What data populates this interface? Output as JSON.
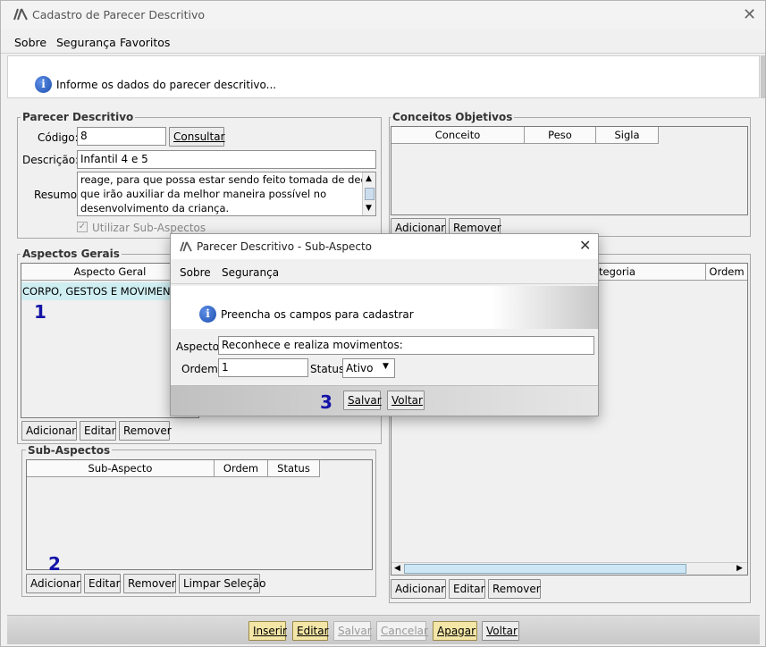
{
  "window": {
    "title": "Cadastro de Parecer Descritivo"
  },
  "menu": [
    "Sobre",
    "Segurança",
    "Favoritos"
  ],
  "info": "Informe os dados do parecer descritivo...",
  "parecer": {
    "group_title": "Parecer Descritivo",
    "codigo_label": "Código:",
    "codigo_value": "8",
    "consultar": "Consultar",
    "descricao_label": "Descrição:*",
    "descricao_value": "Infantil 4 e 5",
    "resumo_label": "Resumo:",
    "resumo_lines": [
      "reage, para que possa estar sendo feito tomada de decisões",
      "que irão  auxiliar da melhor maneira possível no",
      "desenvolvimento da criança."
    ],
    "utilizar_label": "Utilizar Sub-Aspectos"
  },
  "conceitos": {
    "group_title": "Conceitos Objetivos",
    "headers": [
      "Conceito",
      "Peso",
      "Sigla"
    ],
    "adicionar": "Adicionar",
    "remover": "Remover"
  },
  "aspectos": {
    "group_title": "Aspectos Gerais",
    "header": "Aspecto Geral",
    "row": "CORPO, GESTOS E MOVIMENTOS",
    "adicionar": "Adicionar",
    "editar": "Editar",
    "remover": "Remover"
  },
  "subaspectos": {
    "group_title": "Sub-Aspectos",
    "headers": [
      "Sub-Aspecto",
      "Ordem",
      "Status"
    ],
    "adicionar": "Adicionar",
    "editar": "Editar",
    "remover": "Remover",
    "limpar": "Limpar Seleção"
  },
  "right_table": {
    "headers": [
      "tegoria",
      "Ordem"
    ],
    "adicionar": "Adicionar",
    "editar": "Editar",
    "remover": "Remover"
  },
  "bottom": {
    "inserir": "Inserir",
    "editar": "Editar",
    "salvar": "Salvar",
    "cancelar": "Cancelar",
    "apagar": "Apagar",
    "voltar": "Voltar"
  },
  "dialog": {
    "title": "Parecer Descritivo - Sub-Aspecto",
    "menu": [
      "Sobre",
      "Segurança"
    ],
    "info": "Preencha os campos para cadastrar",
    "aspecto_label": "Aspecto:",
    "aspecto_value": "Reconhece e realiza movimentos:",
    "ordem_label": "Ordem:",
    "ordem_value": "1",
    "status_label": "Status:",
    "status_value": "Ativo",
    "salvar": "Salvar",
    "voltar": "Voltar"
  },
  "markers": [
    "1",
    "2",
    "3"
  ]
}
